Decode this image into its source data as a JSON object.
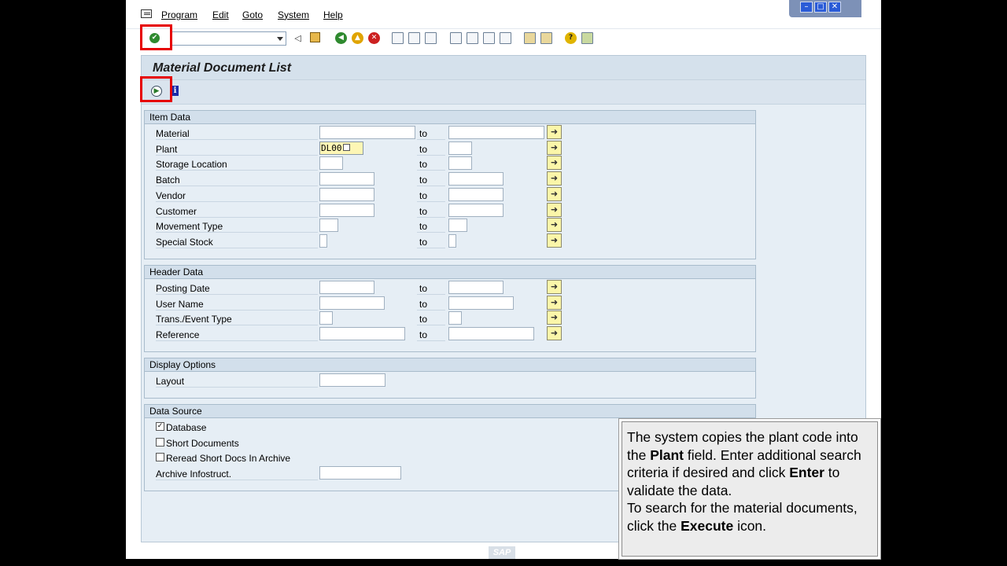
{
  "menu": {
    "items": [
      "Program",
      "Edit",
      "Goto",
      "System",
      "Help"
    ]
  },
  "toolbar": {
    "command_field_value": "",
    "icons": [
      "enter-icon",
      "command-dropdown-icon",
      "back-icon",
      "save-icon",
      "back-green-icon",
      "exit-icon",
      "cancel-icon",
      "print-icon",
      "find-icon",
      "find-next-icon",
      "first-page-icon",
      "previous-page-icon",
      "next-page-icon",
      "last-page-icon",
      "create-session-icon",
      "shortcut-icon",
      "help-icon",
      "layout-menu-icon"
    ]
  },
  "screen": {
    "title": "Material Document List",
    "app_toolbar_icons": [
      "execute-icon",
      "info-icon"
    ]
  },
  "groups": {
    "item_data": {
      "title": "Item Data",
      "rows": [
        {
          "label": "Material",
          "from": "",
          "to_label": "to",
          "to": ""
        },
        {
          "label": "Plant",
          "from": "DL00",
          "to_label": "to",
          "to": ""
        },
        {
          "label": "Storage Location",
          "from": "",
          "to_label": "to",
          "to": ""
        },
        {
          "label": "Batch",
          "from": "",
          "to_label": "to",
          "to": ""
        },
        {
          "label": "Vendor",
          "from": "",
          "to_label": "to",
          "to": ""
        },
        {
          "label": "Customer",
          "from": "",
          "to_label": "to",
          "to": ""
        },
        {
          "label": "Movement Type",
          "from": "",
          "to_label": "to",
          "to": ""
        },
        {
          "label": "Special Stock",
          "from": "",
          "to_label": "to",
          "to": ""
        }
      ]
    },
    "header_data": {
      "title": "Header Data",
      "rows": [
        {
          "label": "Posting Date",
          "from": "",
          "to_label": "to",
          "to": ""
        },
        {
          "label": "User Name",
          "from": "",
          "to_label": "to",
          "to": ""
        },
        {
          "label": "Trans./Event Type",
          "from": "",
          "to_label": "to",
          "to": ""
        },
        {
          "label": "Reference",
          "from": "",
          "to_label": "to",
          "to": ""
        }
      ]
    },
    "display_options": {
      "title": "Display Options",
      "rows": [
        {
          "label": "Layout",
          "value": ""
        }
      ]
    },
    "data_source": {
      "title": "Data Source",
      "checkboxes": [
        {
          "label": "Database",
          "checked": true
        },
        {
          "label": "Short Documents",
          "checked": false
        },
        {
          "label": "Reread Short Docs In Archive",
          "checked": false
        }
      ],
      "archive_label": "Archive Infostruct.",
      "archive_value": ""
    }
  },
  "callout": {
    "t1": "The system copies the plant code into the ",
    "b1": "Plant",
    "t2": " field.  Enter additional search criteria if desired and click ",
    "b2": "Enter",
    "t3": " to validate the data.",
    "t4": "To search for the material documents, click the ",
    "b3": "Execute",
    "t5": " icon."
  },
  "branding": {
    "logo_text": "SAP"
  },
  "colors": {
    "highlight": "#e60000",
    "screen_background": "#e6eef5",
    "input_filled": "#fdf6b5",
    "multiple_selection_button": "#fbf6a9"
  }
}
